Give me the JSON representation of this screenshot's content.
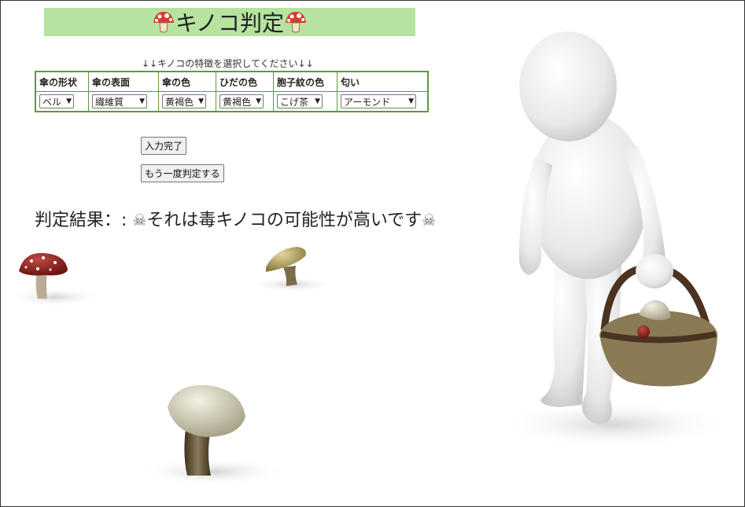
{
  "header": {
    "title": "キノコ判定",
    "mushroom_icon_left": "mushroom-icon",
    "mushroom_icon_right": "mushroom-icon",
    "bg_color": "#b6e3a0"
  },
  "instruction": "↓↓キノコの特徴を選択してください↓↓",
  "features": {
    "headers": [
      "傘の形状",
      "傘の表面",
      "傘の色",
      "ひだの色",
      "胞子紋の色",
      "匂い"
    ],
    "selected": [
      "ベル",
      "繊維質",
      "黄褐色",
      "黄褐色",
      "こげ茶",
      "アーモンド"
    ]
  },
  "buttons": {
    "submit": "入力完了",
    "retry": "もう一度判定する"
  },
  "result": {
    "label": "判定結果：:",
    "text": "それは毒キノコの可能性が高いです",
    "icon": "☠"
  },
  "colors": {
    "table_border": "#5f9a3a",
    "frame": "#333333"
  }
}
